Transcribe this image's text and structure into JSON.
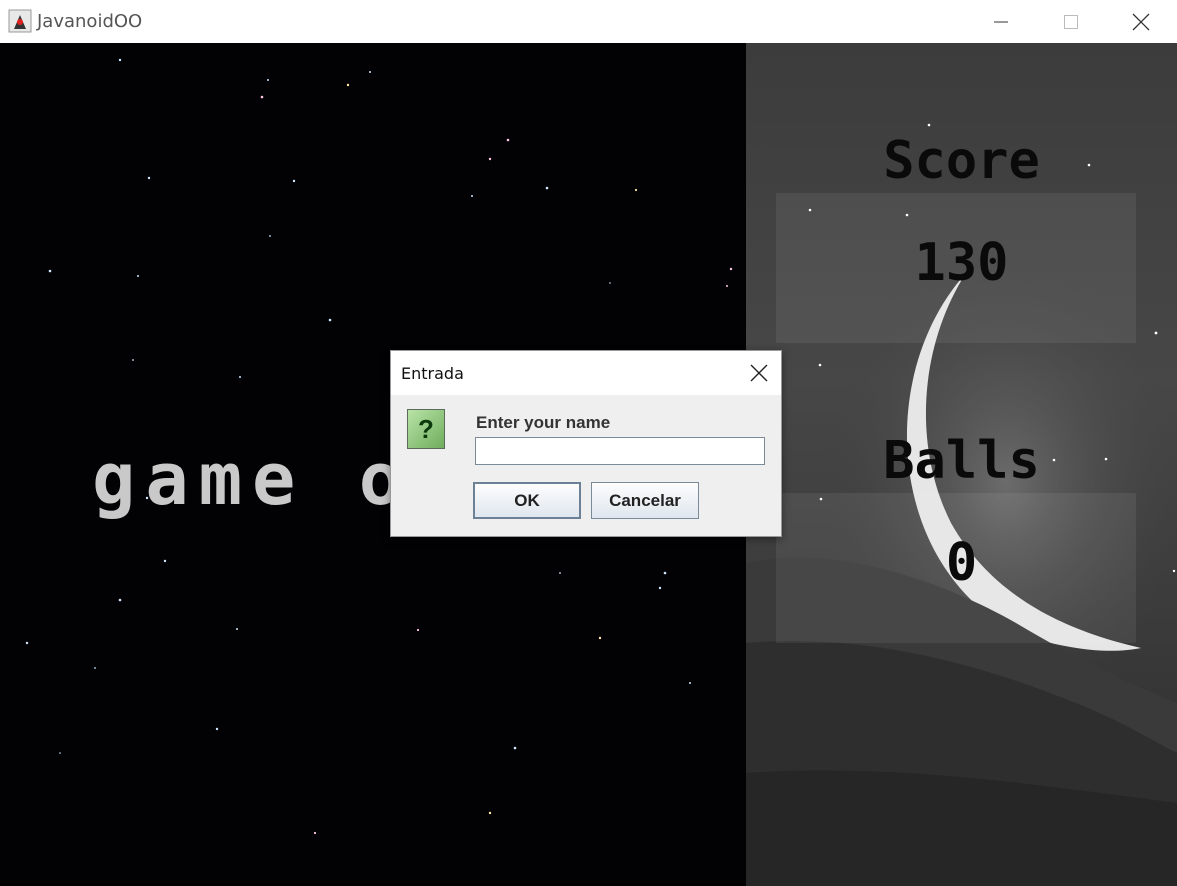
{
  "window": {
    "title": "JavanoidOO",
    "icon": "java-duke-icon",
    "controls": [
      "minimize-icon",
      "maximize-icon",
      "close-icon"
    ]
  },
  "game": {
    "message": "game o"
  },
  "side_panel": {
    "score_label": "Score",
    "score_value": "130",
    "balls_label": "Balls",
    "balls_value": "0"
  },
  "dialog": {
    "title": "Entrada",
    "icon": "question-icon",
    "icon_glyph": "?",
    "prompt": "Enter your name",
    "input_value": "",
    "ok_label": "OK",
    "cancel_label": "Cancelar"
  },
  "colors": {
    "game_background": "#020204",
    "message_text": "#c9c9c9",
    "panel_background": "#474747",
    "dialog_background": "#efefef"
  }
}
